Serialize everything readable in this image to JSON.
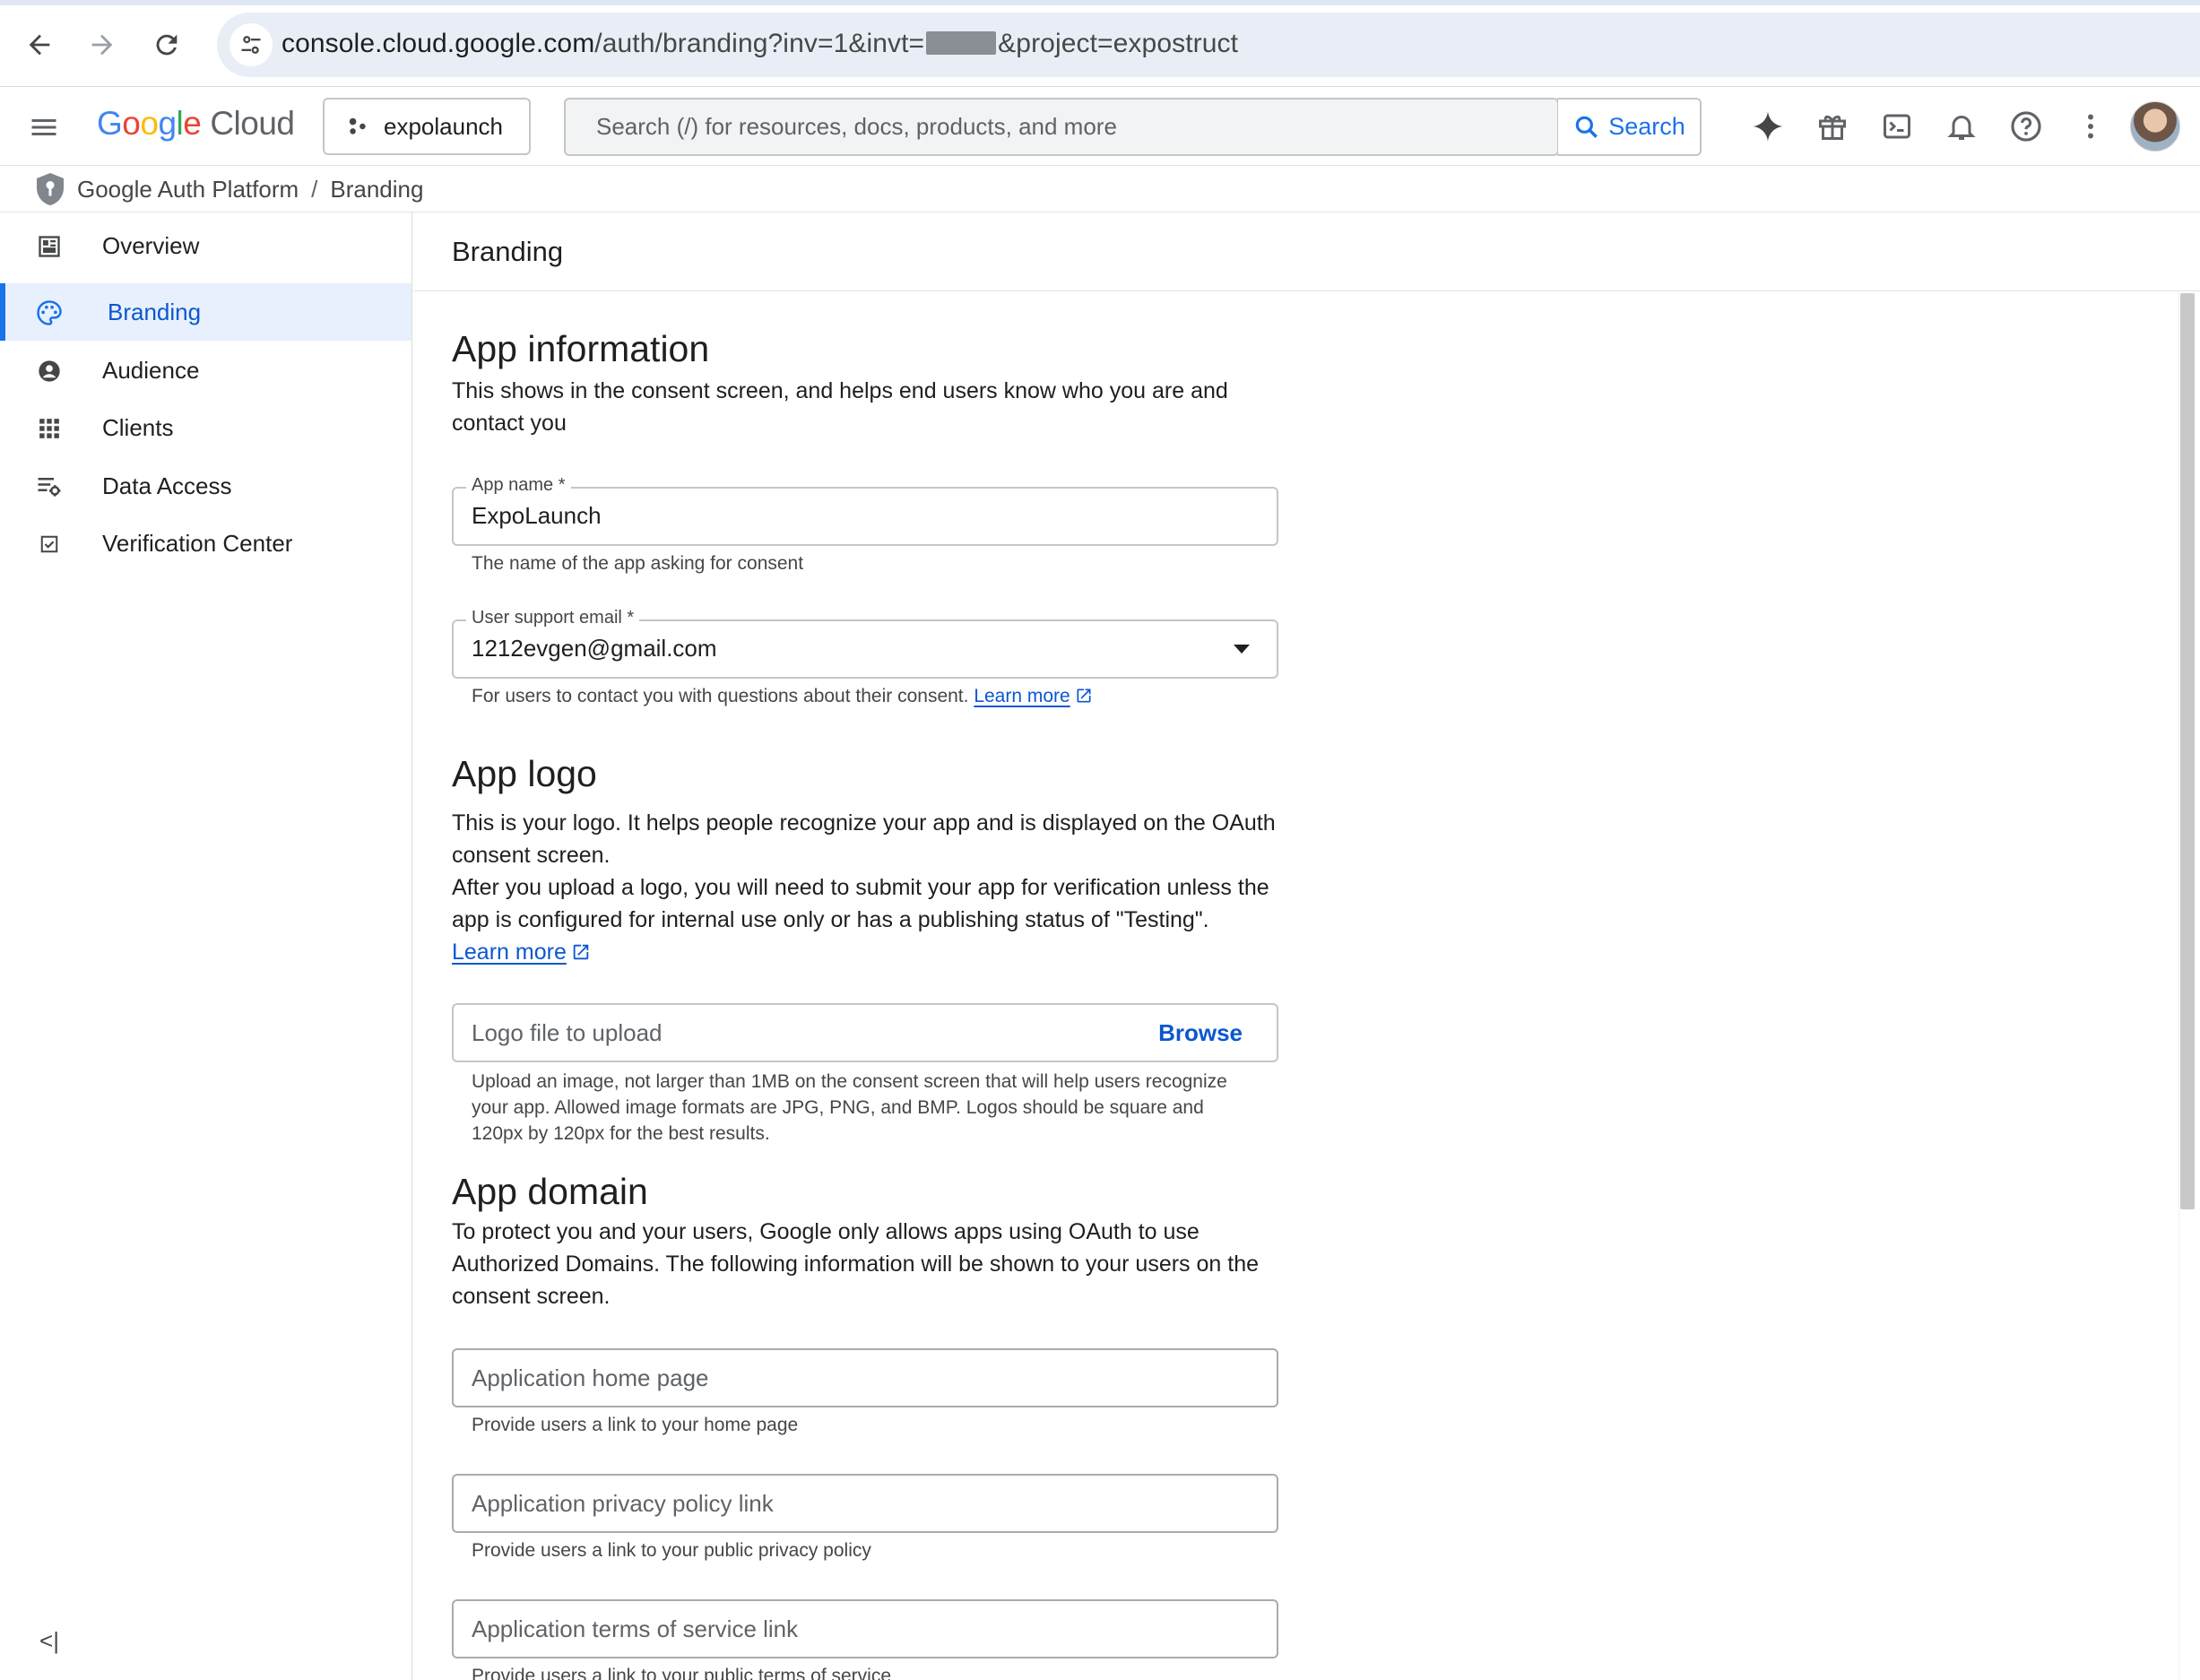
{
  "browser": {
    "url_host": "console.cloud.google.com",
    "url_path_before": "/auth/branding?inv=1&invt=",
    "url_path_after": "&project=expostruct",
    "icons": [
      "back-arrow-icon",
      "forward-arrow-icon",
      "reload-icon",
      "site-info-icon"
    ]
  },
  "header": {
    "logo_word": "Google",
    "logo_product": "Cloud",
    "project_name": "expolaunch",
    "search_placeholder": "Search (/) for resources, docs, products, and more",
    "search_button": "Search",
    "icons": [
      "gemini-spark-icon",
      "gift-icon",
      "cloud-shell-icon",
      "notifications-bell-icon",
      "help-icon",
      "more-vert-icon"
    ]
  },
  "breadcrumb": {
    "root": "Google Auth Platform",
    "separator": "/",
    "current": "Branding"
  },
  "sidebar": {
    "items": [
      {
        "label": "Overview",
        "icon": "dashboard-icon",
        "active": false
      },
      {
        "label": "Branding",
        "icon": "palette-icon",
        "active": true
      },
      {
        "label": "Audience",
        "icon": "account-circle-icon",
        "active": false
      },
      {
        "label": "Clients",
        "icon": "apps-grid-icon",
        "active": false
      },
      {
        "label": "Data Access",
        "icon": "tune-settings-icon",
        "active": false
      },
      {
        "label": "Verification Center",
        "icon": "checkbox-icon",
        "active": false
      }
    ],
    "collapse_label": "<|"
  },
  "page": {
    "title": "Branding"
  },
  "app_information": {
    "heading": "App information",
    "description": "This shows in the consent screen, and helps end users know who you are and contact you",
    "app_name_label": "App name *",
    "app_name_value": "ExpoLaunch",
    "app_name_hint": "The name of the app asking for consent",
    "support_email_label": "User support email *",
    "support_email_value": "1212evgen@gmail.com",
    "support_email_hint": "For users to contact you with questions about their consent.",
    "learn_more": "Learn more"
  },
  "app_logo": {
    "heading": "App logo",
    "description_1": "This is your logo. It helps people recognize your app and is displayed on the OAuth consent screen.",
    "description_2": "After you upload a logo, you will need to submit your app for verification unless the app is configured for internal use only or has a publishing status of \"Testing\".",
    "learn_more": "Learn more",
    "upload_placeholder": "Logo file to upload",
    "browse": "Browse",
    "upload_hint": "Upload an image, not larger than 1MB on the consent screen that will help users recognize your app. Allowed image formats are JPG, PNG, and BMP. Logos should be square and 120px by 120px for the best results."
  },
  "app_domain": {
    "heading": "App domain",
    "description": "To protect you and your users, Google only allows apps using OAuth to use Authorized Domains. The following information will be shown to your users on the consent screen.",
    "home_page_placeholder": "Application home page",
    "home_page_hint": "Provide users a link to your home page",
    "privacy_placeholder": "Application privacy policy link",
    "privacy_hint": "Provide users a link to your public privacy policy",
    "tos_placeholder": "Application terms of service link",
    "tos_hint": "Provide users a link to your public terms of service"
  }
}
